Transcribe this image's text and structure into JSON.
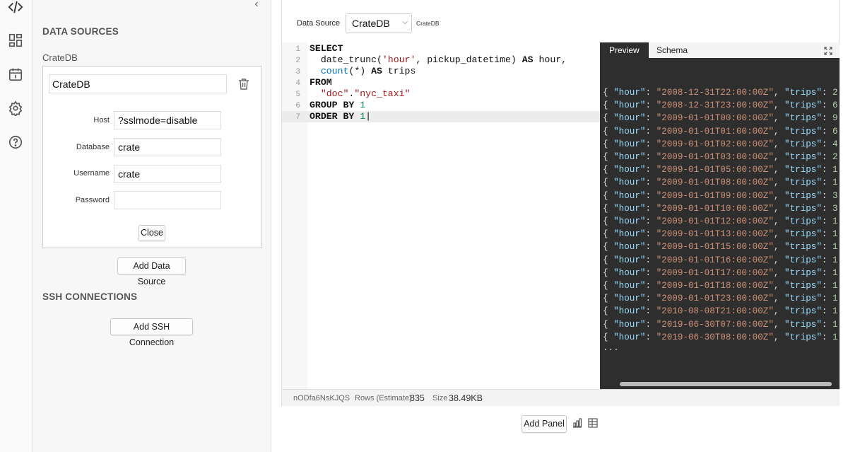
{
  "rail": {
    "icons": [
      "code-icon",
      "dashboard-icon",
      "calendar-icon",
      "settings-icon",
      "help-icon"
    ]
  },
  "sidebar": {
    "data_sources_title": "DATA SOURCES",
    "datasource_name": "CrateDB",
    "card": {
      "title_value": "CrateDB",
      "host_label": "Host",
      "host_value": "?sslmode=disable",
      "database_label": "Database",
      "database_value": "crate",
      "username_label": "Username",
      "username_value": "crate",
      "password_label": "Password",
      "password_value": "",
      "close_label": "Close"
    },
    "add_data_source_label": "Add Data Source",
    "ssh_title": "SSH CONNECTIONS",
    "add_ssh_label": "Add SSH Connection"
  },
  "panel": {
    "data_source_label": "Data Source",
    "data_source_selected": "CrateDB",
    "data_source_badge": "CrateDB",
    "editor_lines": [
      "1",
      "2",
      "3",
      "4",
      "5",
      "6",
      "7"
    ],
    "preview_tab": "Preview",
    "schema_tab": "Schema",
    "results": [
      {
        "hour": "2008-12-31T22:00:00Z",
        "trips": "2"
      },
      {
        "hour": "2008-12-31T23:00:00Z",
        "trips": "6"
      },
      {
        "hour": "2009-01-01T00:00:00Z",
        "trips": "9"
      },
      {
        "hour": "2009-01-01T01:00:00Z",
        "trips": "6"
      },
      {
        "hour": "2009-01-01T02:00:00Z",
        "trips": "4"
      },
      {
        "hour": "2009-01-01T03:00:00Z",
        "trips": "2"
      },
      {
        "hour": "2009-01-01T05:00:00Z",
        "trips": "1"
      },
      {
        "hour": "2009-01-01T08:00:00Z",
        "trips": "1"
      },
      {
        "hour": "2009-01-01T09:00:00Z",
        "trips": "3"
      },
      {
        "hour": "2009-01-01T10:00:00Z",
        "trips": "3"
      },
      {
        "hour": "2009-01-01T12:00:00Z",
        "trips": "1"
      },
      {
        "hour": "2009-01-01T13:00:00Z",
        "trips": "1"
      },
      {
        "hour": "2009-01-01T15:00:00Z",
        "trips": "1"
      },
      {
        "hour": "2009-01-01T16:00:00Z",
        "trips": "1"
      },
      {
        "hour": "2009-01-01T17:00:00Z",
        "trips": "1"
      },
      {
        "hour": "2009-01-01T18:00:00Z",
        "trips": "1"
      },
      {
        "hour": "2009-01-01T23:00:00Z",
        "trips": "1"
      },
      {
        "hour": "2010-08-08T21:00:00Z",
        "trips": "1"
      },
      {
        "hour": "2019-06-30T07:00:00Z",
        "trips": "1"
      },
      {
        "hour": "2019-06-30T08:00:00Z",
        "trips": "1"
      }
    ],
    "results_more": "...",
    "status": {
      "id": "nODfa6NsKJQS",
      "rows_label": "Rows (Estimate)",
      "rows_value": "835",
      "size_label": "Size",
      "size_value": "38.49KB"
    }
  },
  "add_panel_label": "Add Panel",
  "colors": {
    "preview_bg": "#2e2e2e",
    "json_key": "#9cdcfe",
    "json_string": "#ce9178",
    "sql_string": "#a31515"
  }
}
